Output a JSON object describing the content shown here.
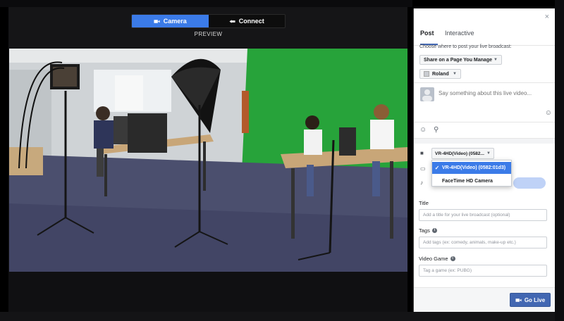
{
  "source_tabs": {
    "camera_label": "Camera",
    "connect_label": "Connect"
  },
  "preview_label": "PREVIEW",
  "panel": {
    "close_symbol": "×",
    "tabs": {
      "post": "Post",
      "interactive": "Interactive"
    },
    "choose_label": "Choose where to post your live broadcast:",
    "post_target": "Share on a Page You Manage",
    "page_name": "Roland",
    "compose_placeholder": "Say something about this live video...",
    "video_source": {
      "selected_short": "VR-4HD(Video) (0582...",
      "options": [
        "VR-4HD(Video) (0582:01d3)",
        "FaceTime HD Camera"
      ],
      "selected_index": 0
    },
    "fields": {
      "title_label": "Title",
      "title_placeholder": "Add a title for your live broadcast (optional)",
      "tags_label": "Tags",
      "tags_placeholder": "Add tags (ex: comedy, animals, make-up etc.)",
      "game_label": "Video Game",
      "game_placeholder": "Tag a game (ex: PUBG)"
    },
    "go_live_label": "Go Live"
  },
  "colors": {
    "accent": "#3b7be8",
    "facebook_blue": "#4267b2"
  },
  "icons": [
    "video-camera-icon",
    "connect-icon",
    "close-icon",
    "smile-icon",
    "location-pin-icon",
    "monitor-icon",
    "microphone-icon",
    "checkmark-icon",
    "info-icon"
  ]
}
